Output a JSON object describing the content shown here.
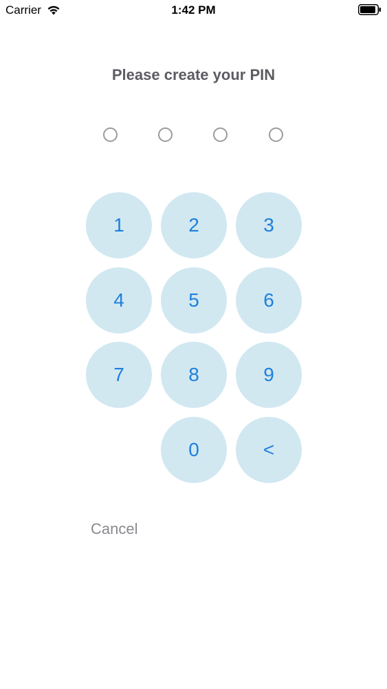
{
  "status_bar": {
    "carrier": "Carrier",
    "time": "1:42 PM",
    "wifi_icon": "wifi-icon",
    "battery_icon": "battery-icon"
  },
  "title": "Please create your PIN",
  "pin": {
    "length": 4,
    "entered": 0
  },
  "keypad": {
    "keys": [
      "1",
      "2",
      "3",
      "4",
      "5",
      "6",
      "7",
      "8",
      "9",
      "0",
      "<"
    ]
  },
  "cancel_label": "Cancel",
  "colors": {
    "key_background": "#d1e8f1",
    "key_text": "#1e7fdc",
    "title_text": "#5c5c62",
    "cancel_text": "#8a8a8f",
    "dot_border": "#9a9a9f"
  }
}
